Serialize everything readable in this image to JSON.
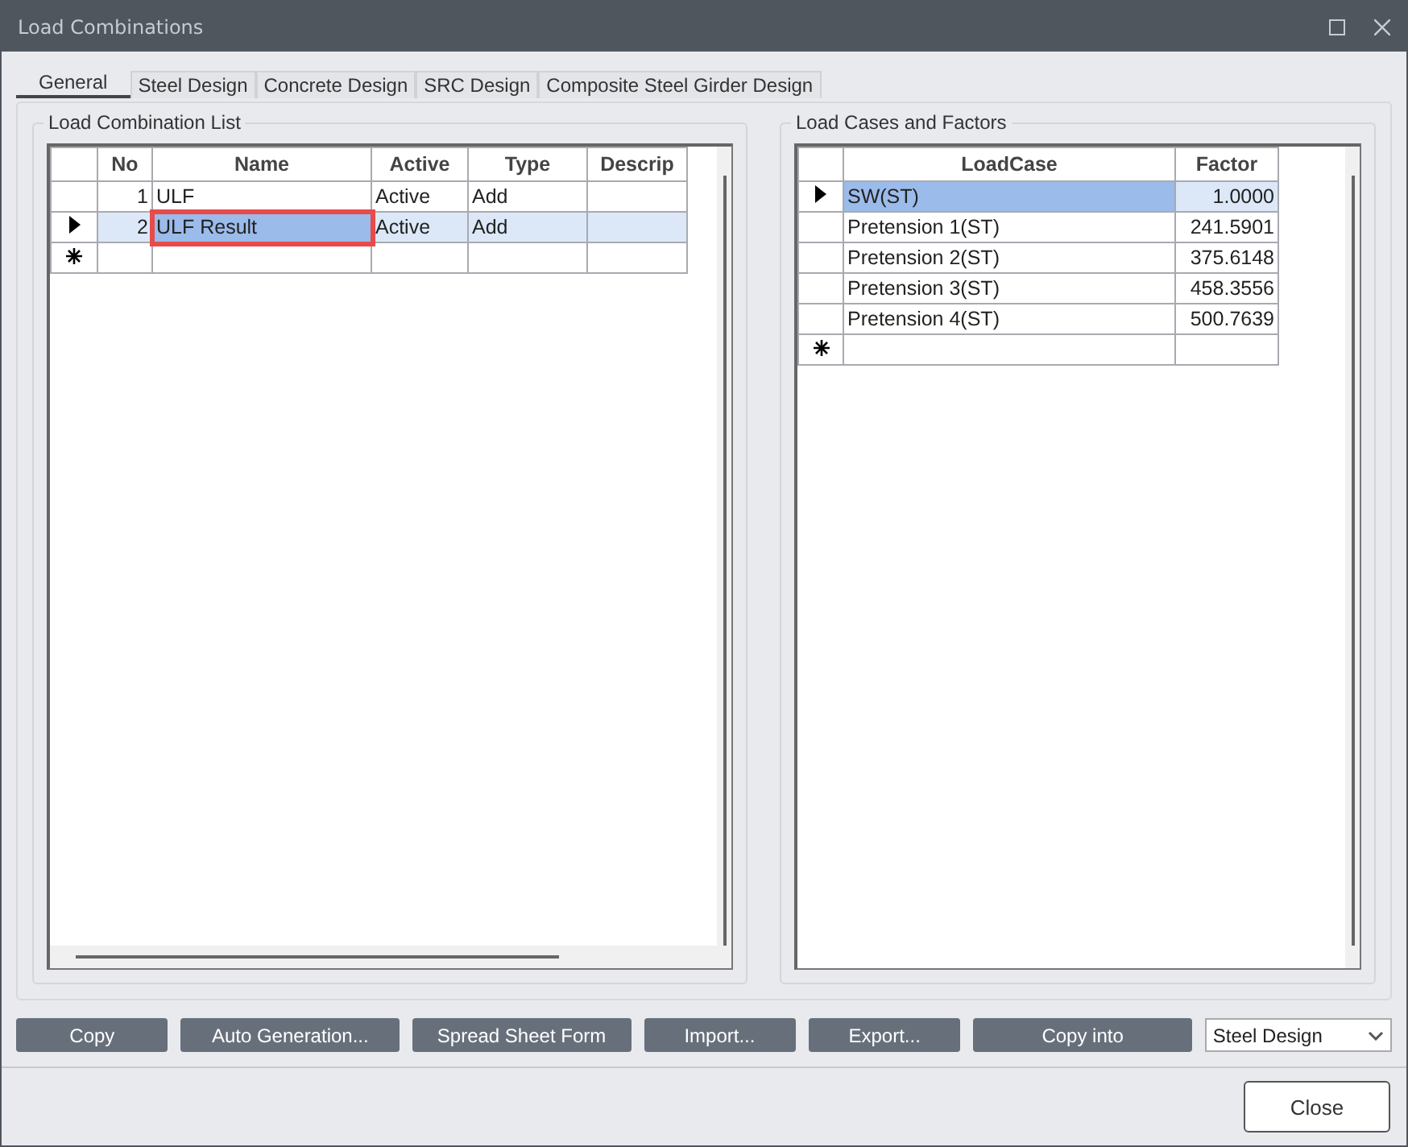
{
  "window": {
    "title": "Load Combinations"
  },
  "tabs": [
    {
      "label": "General",
      "selected": true
    },
    {
      "label": "Steel Design",
      "selected": false
    },
    {
      "label": "Concrete Design",
      "selected": false
    },
    {
      "label": "SRC Design",
      "selected": false
    },
    {
      "label": "Composite Steel Girder Design",
      "selected": false
    }
  ],
  "combination_list": {
    "title": "Load Combination List",
    "columns": [
      "No",
      "Name",
      "Active",
      "Type",
      "Descrip"
    ],
    "rows": [
      {
        "kind": "plain",
        "selected": false,
        "highlighted": false,
        "cells": [
          "1",
          "ULF",
          "Active",
          "Add",
          ""
        ]
      },
      {
        "kind": "current",
        "selected": true,
        "highlighted": true,
        "cells": [
          "2",
          "ULF Result",
          "Active",
          "Add",
          ""
        ]
      },
      {
        "kind": "new",
        "selected": false,
        "highlighted": false,
        "cells": [
          "",
          "",
          "",
          "",
          ""
        ]
      }
    ]
  },
  "load_cases": {
    "title": "Load Cases and Factors",
    "columns": [
      "LoadCase",
      "Factor"
    ],
    "rows": [
      {
        "kind": "current",
        "selected": true,
        "cells": [
          "SW(ST)",
          "1.0000"
        ]
      },
      {
        "kind": "plain",
        "selected": false,
        "cells": [
          "Pretension 1(ST)",
          "241.5901"
        ]
      },
      {
        "kind": "plain",
        "selected": false,
        "cells": [
          "Pretension 2(ST)",
          "375.6148"
        ]
      },
      {
        "kind": "plain",
        "selected": false,
        "cells": [
          "Pretension 3(ST)",
          "458.3556"
        ]
      },
      {
        "kind": "plain",
        "selected": false,
        "cells": [
          "Pretension 4(ST)",
          "500.7639"
        ]
      },
      {
        "kind": "new",
        "selected": false,
        "cells": [
          "",
          ""
        ]
      }
    ]
  },
  "buttons": [
    "Copy",
    "Auto Generation...",
    "Spread Sheet Form",
    "Import...",
    "Export...",
    "Copy into"
  ],
  "design_select": {
    "value": "Steel Design"
  },
  "close_button": "Close"
}
